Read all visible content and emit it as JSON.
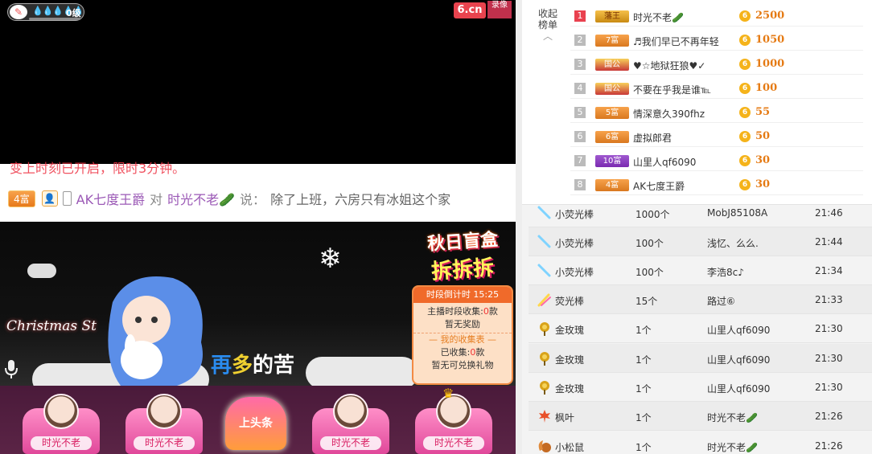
{
  "player": {
    "level_text": "0级",
    "level_drops": "💧💧💧💧💧",
    "logo": "6.cn",
    "logo_side": "录像",
    "chat_prev": "变上时刻已开启，限时3分钟。",
    "chat": {
      "rich_badge": "4富",
      "sender": "AK七度王爵",
      "verb": "对",
      "target": "时光不老🥒",
      "said": "说：",
      "message": "除了上班，六房只有冰姐这个家"
    },
    "stage": {
      "christmas_text": "Christmas St",
      "lyrics_a": "再",
      "lyrics_b": "多",
      "lyrics_c": "的苦"
    },
    "blindbox": {
      "title_1": "秋日盲盒",
      "title_2": "拆拆拆",
      "timer": "时段倒计时 15:25",
      "anchor_collect_prefix": "主播时段收集:",
      "anchor_collect_num": "0",
      "anchor_collect_suffix": "款",
      "no_reward": "暂无奖励",
      "my_collection": "— 我的收集表 —",
      "collected_prefix": "已收集:",
      "collected_num": "0",
      "collected_suffix": "款",
      "no_exchange": "暂无可兑换礼物"
    },
    "seats": [
      {
        "name": "时光不老"
      },
      {
        "name": "时光不老"
      },
      {
        "name": "时光不老"
      },
      {
        "name": "时光不老"
      }
    ],
    "headline": "上头条"
  },
  "rank": {
    "collapse_label": "收起榜单",
    "collapse_arrow": "︿",
    "rows": [
      {
        "no": "1",
        "badge": "藩王",
        "badge_style": "king",
        "user": "时光不老🥒",
        "coin": "6",
        "value": "2500"
      },
      {
        "no": "2",
        "badge": "7富",
        "badge_style": "gold",
        "user": "♬我们早已不再年轻",
        "coin": "6",
        "value": "1050"
      },
      {
        "no": "3",
        "badge": "国公",
        "badge_style": "guo",
        "user": "♥☆地狱狂狼♥✓",
        "coin": "6",
        "value": "1000"
      },
      {
        "no": "4",
        "badge": "国公",
        "badge_style": "guo",
        "user": "不要在乎我是谁℡",
        "coin": "6",
        "value": "100"
      },
      {
        "no": "5",
        "badge": "5富",
        "badge_style": "gold",
        "user": "情深意久390fhz",
        "coin": "6",
        "value": "55"
      },
      {
        "no": "6",
        "badge": "6富",
        "badge_style": "gold",
        "user": "虚拟郎君",
        "coin": "6",
        "value": "50"
      },
      {
        "no": "7",
        "badge": "10富",
        "badge_style": "purple",
        "user": "山里人qf6090",
        "coin": "6",
        "value": "30"
      },
      {
        "no": "8",
        "badge": "4富",
        "badge_style": "gold",
        "user": "AK七度王爵",
        "coin": "6",
        "value": "30"
      }
    ]
  },
  "gifts": [
    {
      "icon": "glowstick-icon",
      "name": "小荧光棒",
      "qty": "1000个",
      "user": "MobJ85108A",
      "time": "21:46"
    },
    {
      "icon": "glowstick-icon",
      "name": "小荧光棒",
      "qty": "100个",
      "user": "浅忆、么么.",
      "time": "21:44"
    },
    {
      "icon": "glowstick-icon",
      "name": "小荧光棒",
      "qty": "100个",
      "user": "李浩8c♪",
      "time": "21:34"
    },
    {
      "icon": "glowstick-big-icon",
      "name": "荧光棒",
      "qty": "15个",
      "user": "路过⑥",
      "time": "21:33"
    },
    {
      "icon": "gold-rose-icon",
      "name": "金玫瑰",
      "qty": "1个",
      "user": "山里人qf6090",
      "time": "21:30"
    },
    {
      "icon": "gold-rose-icon",
      "name": "金玫瑰",
      "qty": "1个",
      "user": "山里人qf6090",
      "time": "21:30"
    },
    {
      "icon": "gold-rose-icon",
      "name": "金玫瑰",
      "qty": "1个",
      "user": "山里人qf6090",
      "time": "21:30"
    },
    {
      "icon": "maple-leaf-icon",
      "name": "枫叶",
      "qty": "1个",
      "user": "时光不老🥒",
      "time": "21:26"
    },
    {
      "icon": "squirrel-icon",
      "name": "小松鼠",
      "qty": "1个",
      "user": "时光不老🥒",
      "time": "21:26"
    }
  ],
  "colors": {
    "accent": "#e9414f",
    "coin": "#f5b31a",
    "value": "#e57a13"
  }
}
